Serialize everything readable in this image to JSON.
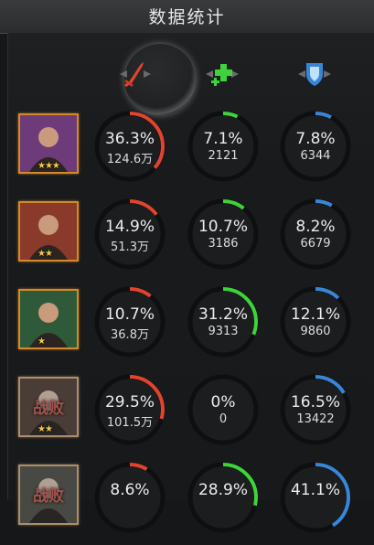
{
  "header": {
    "title": "数据统计"
  },
  "columns": [
    {
      "icon": "attack-sword-icon",
      "color": "#e0442f"
    },
    {
      "icon": "heal-cross-icon",
      "color": "#3ed33b"
    },
    {
      "icon": "shield-icon",
      "color": "#3a86d6"
    }
  ],
  "heroes": [
    {
      "defeated": false,
      "defeat_label": "",
      "stars": "★★★",
      "stats": [
        {
          "pct": "36.3%",
          "value": "124.6万",
          "ratio": 0.363
        },
        {
          "pct": "7.1%",
          "value": "2121",
          "ratio": 0.071
        },
        {
          "pct": "7.8%",
          "value": "6344",
          "ratio": 0.078
        }
      ]
    },
    {
      "defeated": false,
      "defeat_label": "",
      "stars": "★★",
      "stats": [
        {
          "pct": "14.9%",
          "value": "51.3万",
          "ratio": 0.149
        },
        {
          "pct": "10.7%",
          "value": "3186",
          "ratio": 0.107
        },
        {
          "pct": "8.2%",
          "value": "6679",
          "ratio": 0.082
        }
      ]
    },
    {
      "defeated": false,
      "defeat_label": "",
      "stars": "★",
      "stats": [
        {
          "pct": "10.7%",
          "value": "36.8万",
          "ratio": 0.107
        },
        {
          "pct": "31.2%",
          "value": "9313",
          "ratio": 0.312
        },
        {
          "pct": "12.1%",
          "value": "9860",
          "ratio": 0.121
        }
      ]
    },
    {
      "defeated": true,
      "defeat_label": "战败",
      "stars": "★★",
      "stats": [
        {
          "pct": "29.5%",
          "value": "101.5万",
          "ratio": 0.295
        },
        {
          "pct": "0%",
          "value": "0",
          "ratio": 0
        },
        {
          "pct": "16.5%",
          "value": "13422",
          "ratio": 0.165
        }
      ]
    },
    {
      "defeated": true,
      "defeat_label": "战败",
      "stars": "",
      "stats": [
        {
          "pct": "8.6%",
          "value": "",
          "ratio": 0.086
        },
        {
          "pct": "28.9%",
          "value": "",
          "ratio": 0.289
        },
        {
          "pct": "41.1%",
          "value": "",
          "ratio": 0.411
        }
      ]
    }
  ]
}
